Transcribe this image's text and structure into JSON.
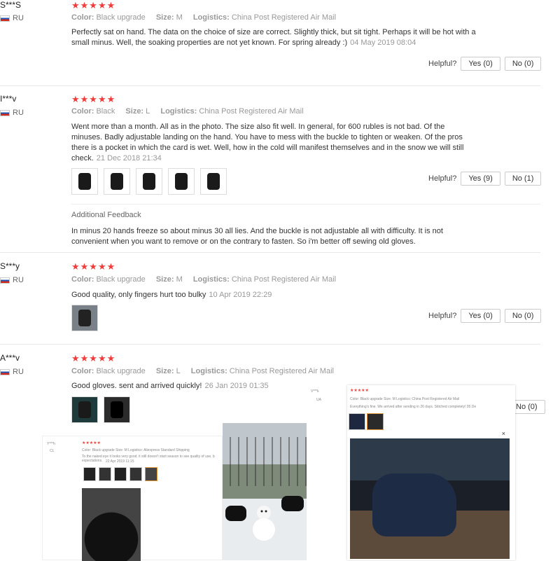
{
  "reviews": [
    {
      "user": "S***S",
      "country": "RU",
      "stars": "★★★★★",
      "color_label": "Color:",
      "color_value": "Black upgrade",
      "size_label": "Size:",
      "size_value": "M",
      "logistics_label": "Logistics:",
      "logistics_value": "China Post Registered Air Mail",
      "text": "Perfectly sat on hand. The data on the choice of size are correct. Slightly thick, but sit tight. Perhaps it will be hot with a small minus. Well, the soaking properties are not yet known. For spring already :)",
      "date": "04 May 2019 08:04",
      "helpful": "Helpful?",
      "yes": "Yes (0)",
      "no": "No (0)"
    },
    {
      "user": "I***v",
      "country": "RU",
      "stars": "★★★★★",
      "color_label": "Color:",
      "color_value": "Black",
      "size_label": "Size:",
      "size_value": "L",
      "logistics_label": "Logistics:",
      "logistics_value": "China Post Registered Air Mail",
      "text": "Went more than a month. All as in the photo. The size also fit well. In general, for 600 rubles is not bad. Of the minuses. Badly adjustable landing on the hand. You have to mess with the buckle to tighten or weaken. Of the pros there is a pocket in which the card is wet. Well, how in the cold will manifest themselves and in the snow we will still check.",
      "date": "21 Dec 2018 21:34",
      "helpful": "Helpful?",
      "yes": "Yes (9)",
      "no": "No (1)",
      "feedback_title": "Additional Feedback",
      "feedback_text": "In minus 20 hands freeze so about minus 30 all lies. And the buckle is not adjustable all with difficulty. It is not convenient when you want to remove or on the contrary to fasten. So i'm better off sewing old gloves."
    },
    {
      "user": "S***y",
      "country": "RU",
      "stars": "★★★★★",
      "color_label": "Color:",
      "color_value": "Black upgrade",
      "size_label": "Size:",
      "size_value": "M",
      "logistics_label": "Logistics:",
      "logistics_value": "China Post Registered Air Mail",
      "text": "Good quality, only fingers hurt too bulky",
      "date": "10 Apr 2019 22:29",
      "helpful": "Helpful?",
      "yes": "Yes (0)",
      "no": "No (0)"
    },
    {
      "user": "A***v",
      "country": "RU",
      "stars": "★★★★★",
      "color_label": "Color:",
      "color_value": "Black upgrade",
      "size_label": "Size:",
      "size_value": "L",
      "logistics_label": "Logistics:",
      "logistics_value": "China Post Registered Air Mail",
      "text": "Good gloves. sent and arrived quickly!",
      "date": "26 Jan 2019 01:35",
      "no": "No (0)"
    }
  ],
  "collage": {
    "left_user": "Y***h",
    "left_country": "CL",
    "left_stars": "★★★★★",
    "left_meta": "Color: Black upgrade   Size: M   Logistics: Aliexpress Standard Shipping",
    "left_text": "To the naked eye it looks very good. it still doesn't start season to see quality of use, b expectations.",
    "left_date": "22 Apr 2019 11:15",
    "right_user": "V***k",
    "right_country": "UA",
    "right_stars": "★★★★★",
    "right_meta": "Color: Black upgrade   Size: M   Logistics: China Post Registered Air Mail",
    "right_text": "Everything's fine. We arrived after sending in 26 days. Stitched completely!",
    "right_date": "05 De",
    "close": "×"
  }
}
